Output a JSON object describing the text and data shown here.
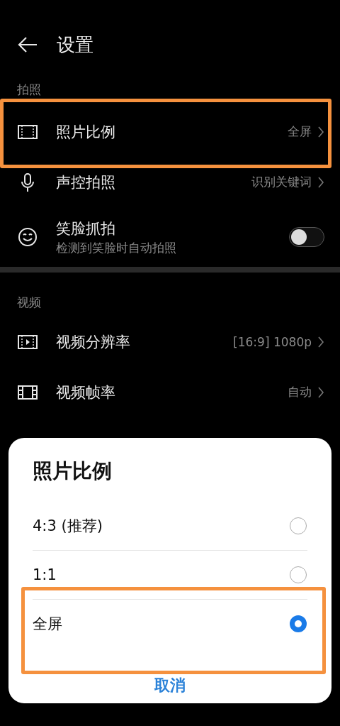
{
  "header": {
    "title": "设置"
  },
  "sections": [
    {
      "title": "拍照",
      "items": [
        {
          "kind": "link",
          "label": "照片比例",
          "value": "全屏",
          "highlighted": true
        },
        {
          "kind": "link",
          "label": "声控拍照",
          "value": "识别关键词",
          "highlighted": false
        },
        {
          "kind": "toggle",
          "label": "笑脸抓拍",
          "subtitle": "检测到笑脸时自动拍照",
          "on": false,
          "highlighted": false
        }
      ]
    },
    {
      "title": "视频",
      "items": [
        {
          "kind": "link",
          "label": "视频分辨率",
          "value": "[16:9] 1080p",
          "highlighted": false
        },
        {
          "kind": "link",
          "label": "视频帧率",
          "value": "自动",
          "highlighted": false
        }
      ]
    }
  ],
  "dialog": {
    "title": "照片比例",
    "options": [
      {
        "label": "4:3 (推荐)",
        "selected": false,
        "highlighted": false
      },
      {
        "label": "1:1",
        "selected": false,
        "highlighted": false
      },
      {
        "label": "全屏",
        "selected": true,
        "highlighted": true
      }
    ],
    "cancel": "取消"
  }
}
